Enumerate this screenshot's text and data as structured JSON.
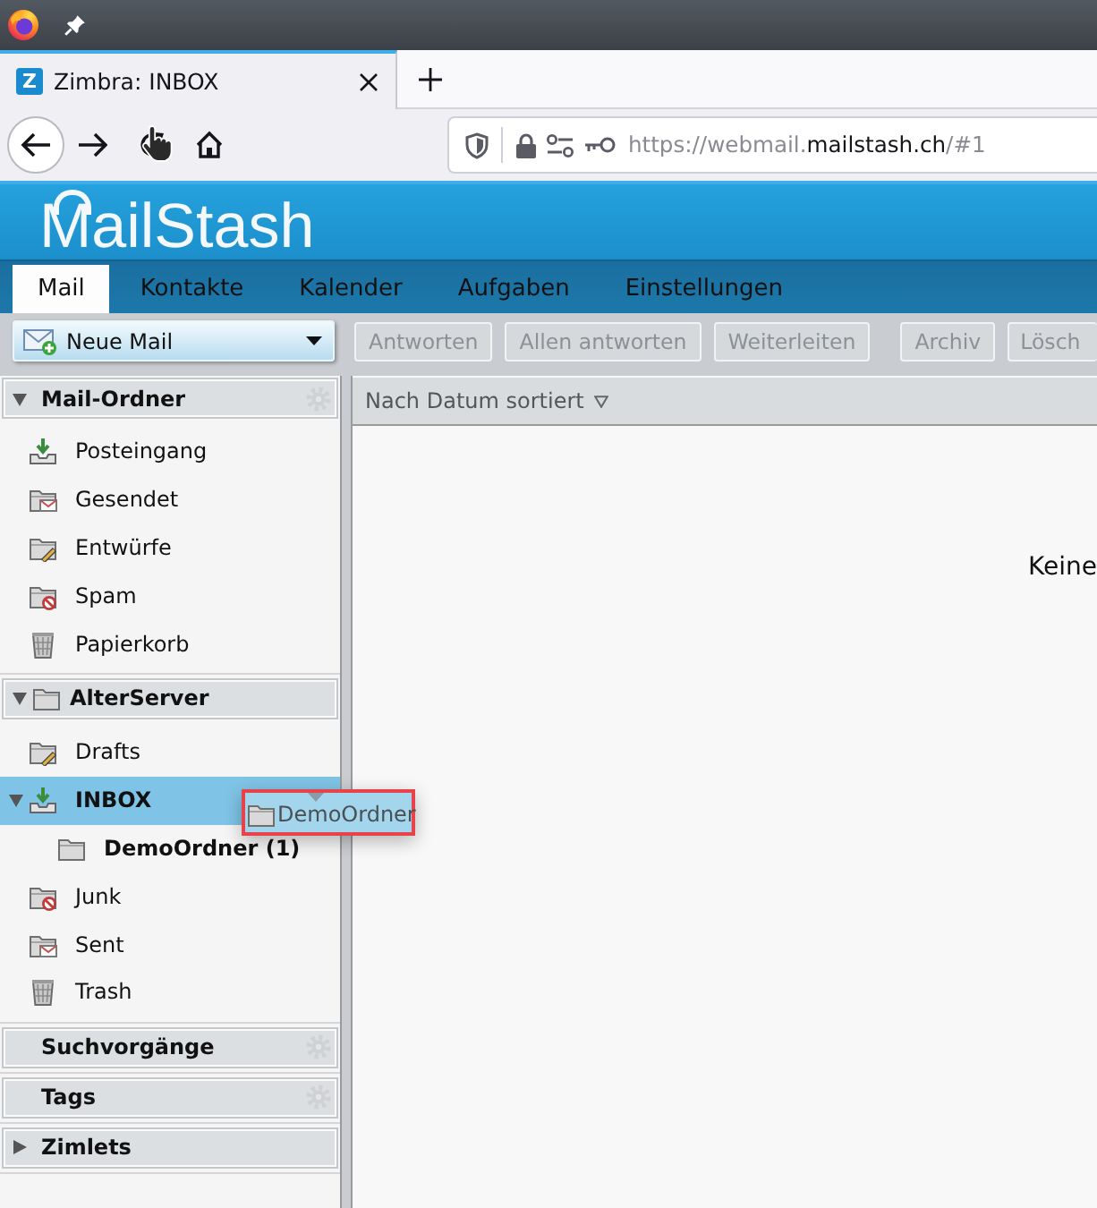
{
  "browser": {
    "tab": {
      "favicon": "Z",
      "title": "Zimbra: INBOX"
    },
    "url": {
      "prefix": "https://webmail.",
      "domain": "mailstash.ch",
      "suffix": "/#1"
    }
  },
  "app": {
    "logo": "MailStash"
  },
  "tabs": [
    {
      "label": "Mail",
      "selected": true
    },
    {
      "label": "Kontakte",
      "selected": false
    },
    {
      "label": "Kalender",
      "selected": false
    },
    {
      "label": "Aufgaben",
      "selected": false
    },
    {
      "label": "Einstellungen",
      "selected": false
    }
  ],
  "toolbar": {
    "new_mail": "Neue Mail",
    "button_groups": [
      [
        {
          "label": "Antworten",
          "disabled": true
        },
        {
          "label": "Allen antworten",
          "disabled": true
        },
        {
          "label": "Weiterleiten",
          "disabled": true
        }
      ],
      [
        {
          "label": "Archiv",
          "disabled": true
        },
        {
          "label": "Lösch",
          "disabled": true
        }
      ]
    ]
  },
  "sidebar": {
    "sections": [
      {
        "title": "Mail-Ordner",
        "kind": "category",
        "expanded": true,
        "has_options": true,
        "items": [
          {
            "label": "Posteingang",
            "kind": "inbox",
            "selected": false,
            "unread": false,
            "expanded": false
          },
          {
            "label": "Gesendet",
            "kind": "sent",
            "selected": false,
            "unread": false,
            "expanded": false
          },
          {
            "label": "Entwürfe",
            "kind": "drafts",
            "selected": false,
            "unread": false,
            "expanded": false
          },
          {
            "label": "Spam",
            "kind": "spam",
            "selected": false,
            "unread": false,
            "expanded": false
          },
          {
            "label": "Papierkorb",
            "kind": "trash",
            "selected": false,
            "unread": false,
            "expanded": false
          }
        ]
      },
      {
        "title": "AlterServer",
        "kind": "account",
        "expanded": true,
        "has_options": false,
        "items": [
          {
            "label": "Drafts",
            "kind": "drafts",
            "selected": false,
            "unread": false,
            "expanded": false
          },
          {
            "label": "INBOX",
            "kind": "inbox",
            "selected": true,
            "unread": true,
            "expanded": true,
            "children": [
              {
                "label": "DemoOrdner (1)",
                "kind": "folder",
                "selected": false,
                "unread": true,
                "expanded": false
              }
            ]
          },
          {
            "label": "Junk",
            "kind": "spam",
            "selected": false,
            "unread": false,
            "expanded": false
          },
          {
            "label": "Sent",
            "kind": "sent",
            "selected": false,
            "unread": false,
            "expanded": false
          },
          {
            "label": "Trash",
            "kind": "trash",
            "selected": false,
            "unread": false,
            "expanded": false
          }
        ]
      },
      {
        "title": "Suchvorgänge",
        "kind": "category",
        "has_options": true
      },
      {
        "title": "Tags",
        "kind": "category",
        "has_options": true
      },
      {
        "title": "Zimlets",
        "kind": "category",
        "expanded": false,
        "has_options": false
      }
    ]
  },
  "drag_preview": {
    "label": "DemoOrdner"
  },
  "message_list": {
    "sort_label": "Nach Datum sortiert",
    "empty_text": "Keine"
  }
}
